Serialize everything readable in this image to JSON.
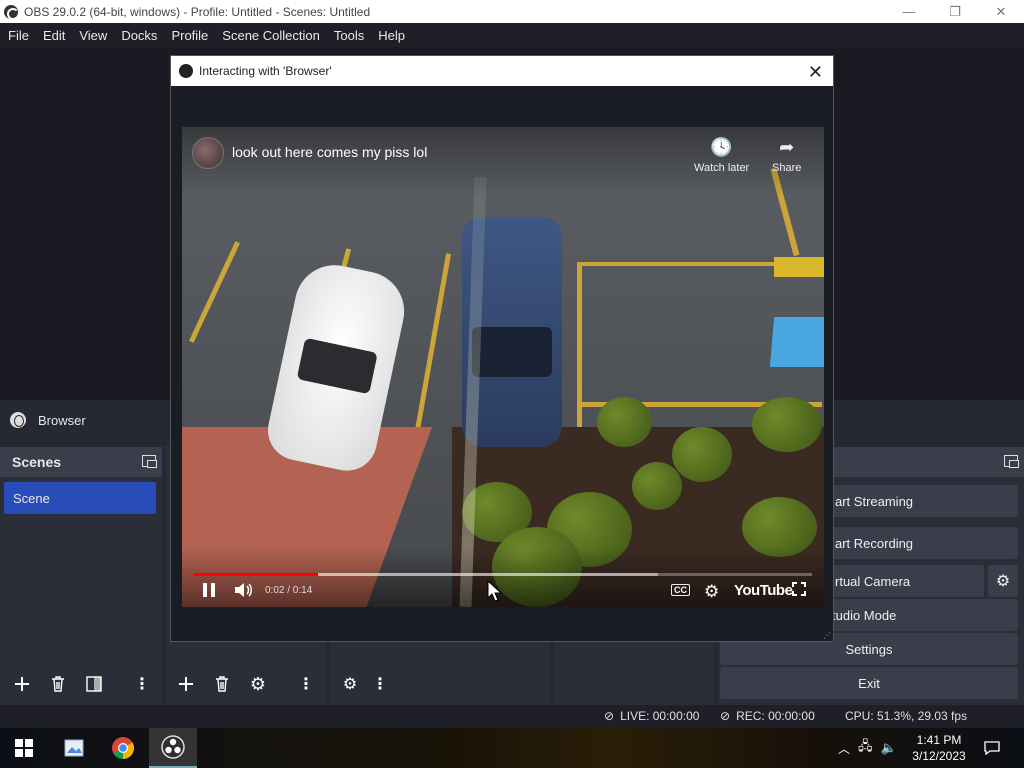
{
  "window": {
    "title": "OBS 29.0.2 (64-bit, windows) - Profile: Untitled - Scenes: Untitled",
    "minimize": "—",
    "maximize": "❐",
    "close": "✕"
  },
  "menu": [
    "File",
    "Edit",
    "View",
    "Docks",
    "Profile",
    "Scene Collection",
    "Tools",
    "Help"
  ],
  "source_bar": {
    "source_name": "Browser"
  },
  "scenes_dock": {
    "title": "Scenes",
    "items": [
      "Scene"
    ]
  },
  "controls": {
    "start_streaming": "art Streaming",
    "start_recording": "art Recording",
    "virtual_camera": "rtual Camera",
    "studio_mode": "tudio Mode",
    "settings": "Settings",
    "exit": "Exit"
  },
  "status": {
    "live": "LIVE: 00:00:00",
    "rec": "REC: 00:00:00",
    "cpu": "CPU: 51.3%, 29.03 fps"
  },
  "dialog": {
    "title": "Interacting with 'Browser'",
    "close": "✕"
  },
  "video": {
    "title": "look out here comes my piss lol",
    "watch_later": "Watch later",
    "share": "Share",
    "time": "0:02 / 0:14",
    "cc": "CC",
    "logo": "YouTube",
    "played_fraction": 0.2,
    "buffered_fraction": 0.75
  },
  "taskbar": {
    "time": "1:41 PM",
    "date": "3/12/2023"
  },
  "colors": {
    "accent_blue": "#284cb8",
    "progress_red": "#ff0000",
    "dock_header": "#3a3d4a"
  }
}
